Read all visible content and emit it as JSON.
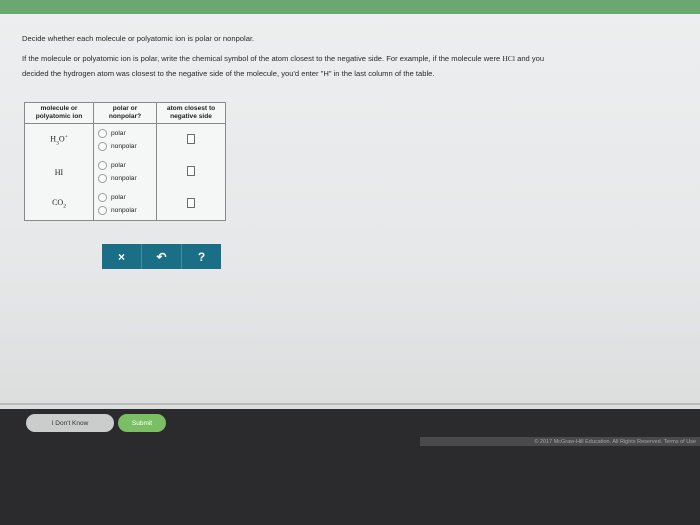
{
  "instructions": {
    "line1": "Decide whether each molecule or polyatomic ion is polar or nonpolar.",
    "line2_pre": "If the molecule or polyatomic ion is polar, write the chemical symbol of the atom closest to the negative side. For example, if the molecule were ",
    "line2_example": "HCl",
    "line2_post": " and you",
    "line3": "decided the hydrogen atom was closest to the negative side of the molecule, you'd enter \"H\" in the last column of the table."
  },
  "table": {
    "headers": {
      "molecule_l1": "molecule or",
      "molecule_l2": "polyatomic ion",
      "polar_l1": "polar or",
      "polar_l2": "nonpolar?",
      "atom_l1": "atom closest to",
      "atom_l2": "negative side"
    },
    "rows": [
      {
        "base1": "H",
        "sub1": "3",
        "base2": "O",
        "sub2": "",
        "sup": "+",
        "polar": "polar",
        "nonpolar": "nonpolar"
      },
      {
        "base1": "HI",
        "sub1": "",
        "base2": "",
        "sub2": "",
        "sup": "",
        "polar": "polar",
        "nonpolar": "nonpolar"
      },
      {
        "base1": "CO",
        "sub1": "2",
        "base2": "",
        "sub2": "",
        "sup": "",
        "polar": "polar",
        "nonpolar": "nonpolar"
      }
    ]
  },
  "tools": {
    "clear_icon": "×",
    "undo_icon": "↶",
    "help_icon": "?"
  },
  "footer": {
    "dont_know": "I Don't Know",
    "submit": "Submit",
    "copyright": "© 2017 McGraw-Hill Education. All Rights Reserved.   Terms of Use"
  },
  "colors": {
    "top_bar": "#6aa86f",
    "tool_bg": "#1a6f86",
    "submit_bg": "#7bbf65"
  }
}
